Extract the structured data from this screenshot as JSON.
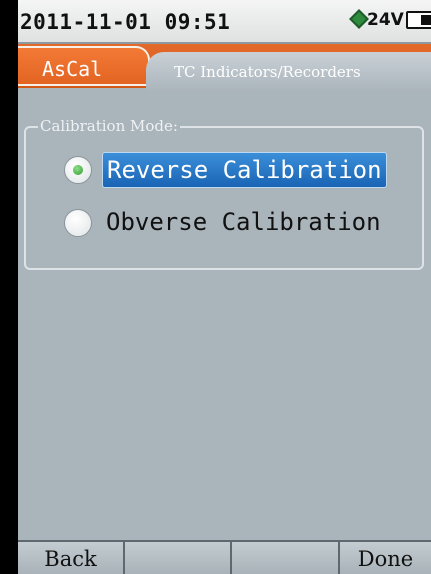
{
  "status": {
    "datetime": "2011-11-01 09:51",
    "voltage": "24V",
    "power_icon": "power-diamond-icon",
    "battery_icon": "battery-icon"
  },
  "tabs": {
    "main_label": "AsCal",
    "sub_label": "TC Indicators/Recorders"
  },
  "calibration": {
    "legend": "Calibration Mode:",
    "options": [
      {
        "label": "Reverse Calibration",
        "selected": true
      },
      {
        "label": "Obverse Calibration",
        "selected": false
      }
    ]
  },
  "softkeys": [
    "Back",
    "",
    "",
    "Done"
  ],
  "colors": {
    "accent_orange": "#e46a2c",
    "selection_blue": "#1a64b5",
    "radio_green": "#2f9a2a",
    "panel_gray": "#aab4bb"
  }
}
